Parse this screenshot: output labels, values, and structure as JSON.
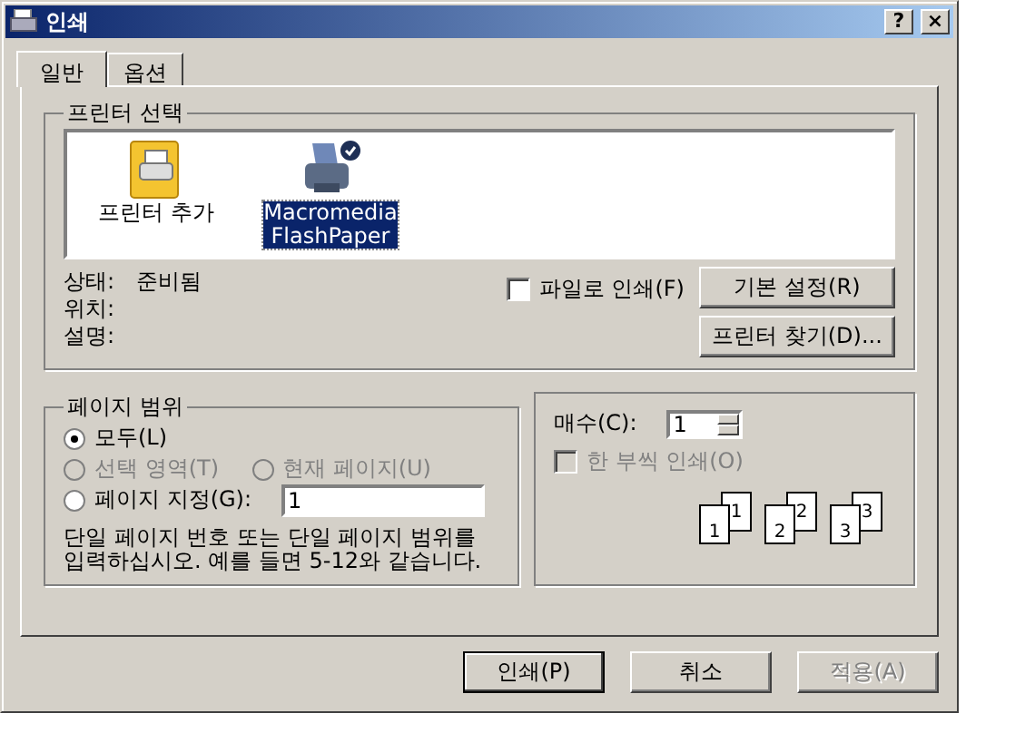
{
  "window": {
    "title": "인쇄",
    "help": "?",
    "close": "×"
  },
  "tabs": [
    {
      "label": "일반",
      "selected": true
    },
    {
      "label": "옵션",
      "selected": false
    }
  ],
  "printer_group": {
    "title": "프린터 선택",
    "printers": [
      {
        "kind": "add",
        "label": "프린터 추가",
        "selected": false
      },
      {
        "kind": "printer",
        "label": "Macromedia FlashPaper",
        "selected": true,
        "is_default": true
      }
    ],
    "status": [
      {
        "label": "상태:",
        "value": "준비됨"
      },
      {
        "label": "위치:"
      },
      {
        "label": "설명:"
      }
    ],
    "print_to_file": {
      "label": "파일로 인쇄(F)",
      "checked": false
    },
    "buttons": [
      "기본 설정(R)",
      "프린터 찾기(D)..."
    ]
  },
  "page_range": {
    "title": "페이지 범위",
    "options": [
      {
        "label": "모두(L)",
        "selected": true,
        "disabled": false
      },
      {
        "label": "선택 영역(T)",
        "selected": false,
        "disabled": true
      },
      {
        "label": "현재 페이지(U)",
        "selected": false,
        "disabled": true
      },
      {
        "label": "페이지 지정(G):",
        "selected": false,
        "disabled": false,
        "value": "1"
      }
    ],
    "hint": "단일 페이지 번호 또는 단일 페이지 범위를 입력하십시오. 예를 들면 5-12와 같습니다."
  },
  "copies": {
    "label": "매수(C):",
    "value": "1",
    "collate": {
      "label": "한 부씩 인쇄(O)",
      "checked": false,
      "disabled": true
    },
    "pages": [
      {
        "front": "1",
        "back": "1"
      },
      {
        "front": "2",
        "back": "2"
      },
      {
        "front": "3",
        "back": "3"
      }
    ]
  },
  "buttons": [
    {
      "label": "인쇄(P)",
      "disabled": false,
      "default": true
    },
    {
      "label": "취소",
      "disabled": false,
      "default": false
    },
    {
      "label": "적용(A)",
      "disabled": true,
      "default": false
    }
  ]
}
